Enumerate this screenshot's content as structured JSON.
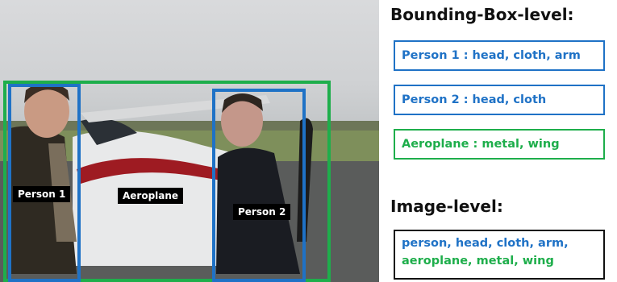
{
  "photo": {
    "labels": {
      "person1": "Person 1",
      "aeroplane": "Aeroplane",
      "person2": "Person 2"
    },
    "box_colors": {
      "person": "#1f72c6",
      "aeroplane": "#1eae4b"
    }
  },
  "bbox_level": {
    "heading": "Bounding-Box-level:",
    "items": [
      {
        "text": "Person 1 :  head, cloth, arm",
        "color": "#1f72c6"
      },
      {
        "text": "Person 2 :  head, cloth",
        "color": "#1f72c6"
      },
      {
        "text": "Aeroplane :  metal, wing",
        "color": "#1eae4b"
      }
    ]
  },
  "image_level": {
    "heading": "Image-level:",
    "line1": "person, head, cloth, arm,",
    "line2": "aeroplane, metal, wing"
  }
}
